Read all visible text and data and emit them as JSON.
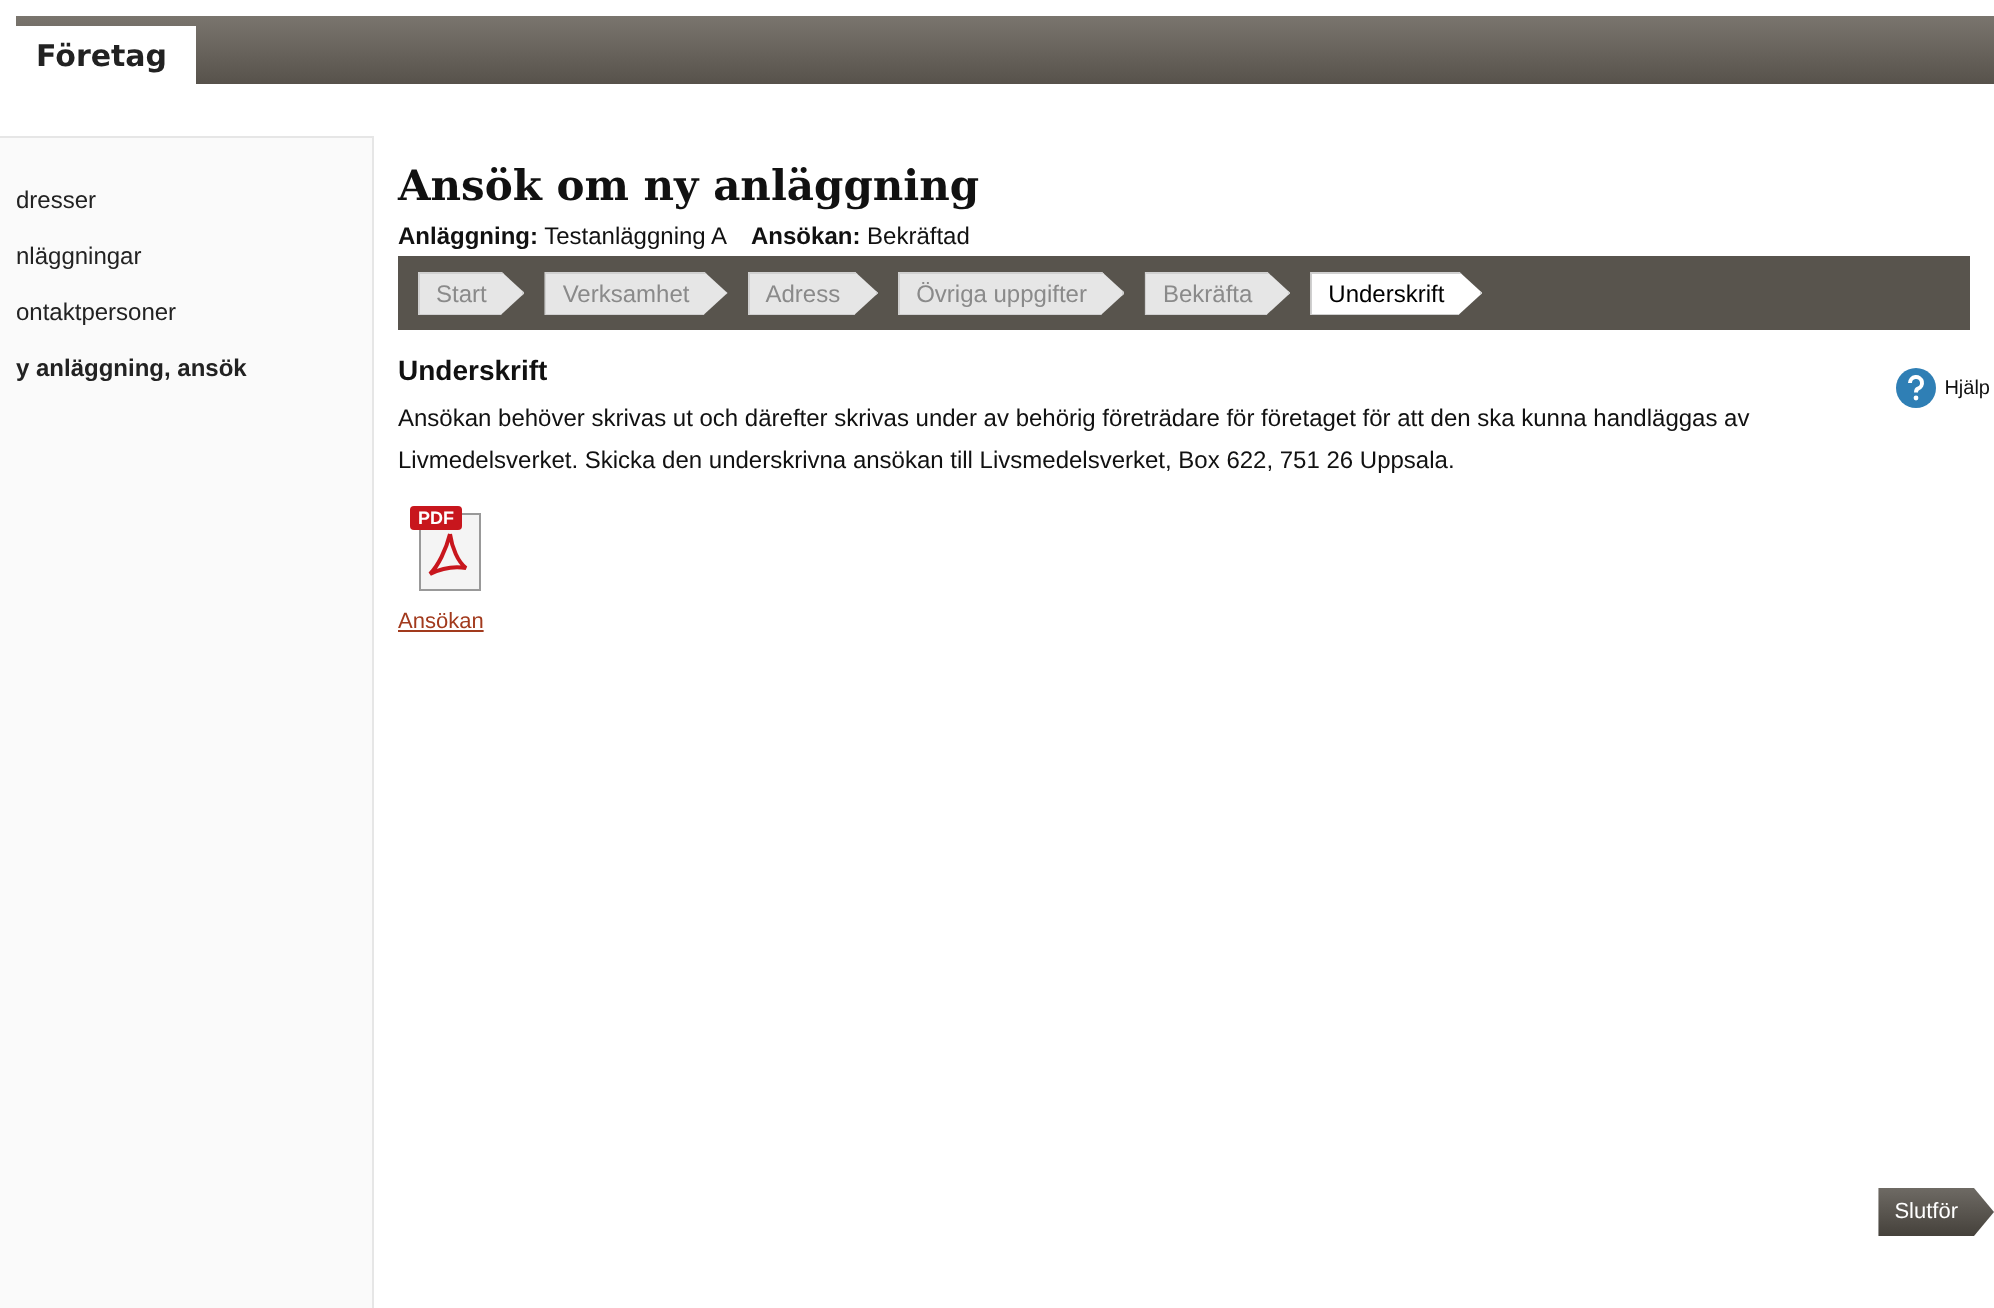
{
  "top_tabs": [
    {
      "label": "Företag",
      "selected": true
    }
  ],
  "sidebar": {
    "items": [
      {
        "label": "dresser",
        "selected": false
      },
      {
        "label": "nläggningar",
        "selected": false
      },
      {
        "label": "ontaktpersoner",
        "selected": false
      },
      {
        "label": "y anläggning, ansök",
        "selected": true
      }
    ]
  },
  "page": {
    "title": "Ansök om ny anläggning",
    "info": [
      {
        "label": "Anläggning:",
        "value": "Testanläggning A"
      },
      {
        "label": "Ansökan:",
        "value": "Bekräftad"
      }
    ],
    "steps": [
      {
        "label": "Start",
        "selected": false
      },
      {
        "label": "Verksamhet",
        "selected": false
      },
      {
        "label": "Adress",
        "selected": false
      },
      {
        "label": "Övriga uppgifter",
        "selected": false
      },
      {
        "label": "Bekräfta",
        "selected": false
      },
      {
        "label": "Underskrift",
        "selected": true
      }
    ],
    "section_title": "Underskrift",
    "help": "Hjälp",
    "text": "Ansökan behöver skrivas ut och därefter skrivas under av behörig företrädare för företaget för att den ska kunna handläggas av Livmedelsverket. Skicka den underskrivna ansökan till Livsmedelsverket, Box 622, 751 26 Uppsala.",
    "document": {
      "icon_label": "PDF",
      "link": "Ansökan"
    },
    "finish_button": "Slutför"
  }
}
